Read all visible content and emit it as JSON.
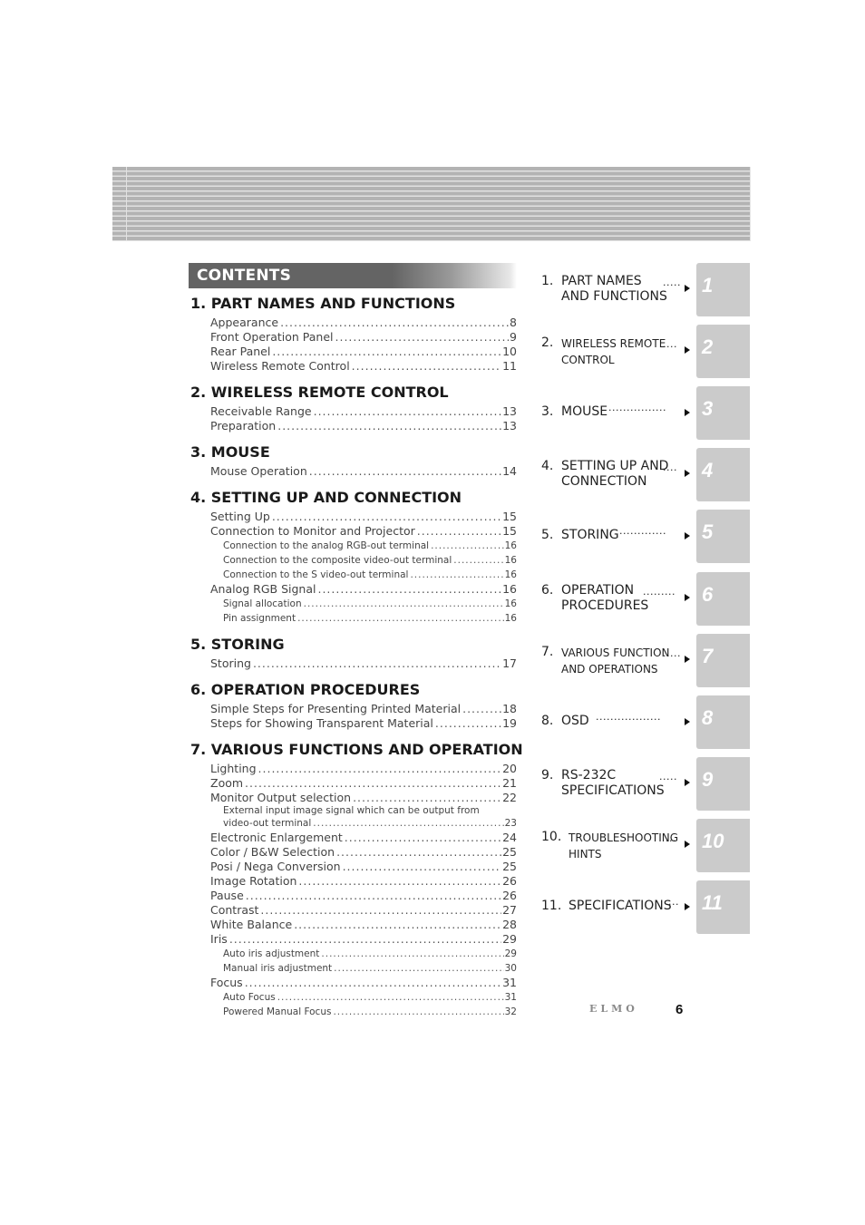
{
  "contents_title": "CONTENTS",
  "sections": [
    {
      "title": "1. PART NAMES AND FUNCTIONS",
      "entries": [
        {
          "label": "Appearance",
          "page": "8"
        },
        {
          "label": "Front Operation Panel",
          "page": "9"
        },
        {
          "label": "Rear Panel",
          "page": "10"
        },
        {
          "label": "Wireless Remote Control",
          "page": "11"
        }
      ]
    },
    {
      "title": "2. WIRELESS REMOTE CONTROL",
      "entries": [
        {
          "label": "Receivable Range",
          "page": "13"
        },
        {
          "label": "Preparation",
          "page": "13"
        }
      ]
    },
    {
      "title": "3. MOUSE",
      "entries": [
        {
          "label": "Mouse Operation",
          "page": "14"
        }
      ]
    },
    {
      "title": "4. SETTING UP AND CONNECTION",
      "entries": [
        {
          "label": "Setting Up",
          "page": "15"
        },
        {
          "label": "Connection to Monitor and Projector",
          "page": "15"
        },
        {
          "label": "Connection to the analog RGB-out terminal",
          "page": "16",
          "sub": true
        },
        {
          "label": "Connection to the composite video-out terminal",
          "page": "16",
          "sub": true
        },
        {
          "label": "Connection to the S video-out terminal",
          "page": "16",
          "sub": true
        },
        {
          "label": "Analog RGB Signal",
          "page": "16"
        },
        {
          "label": "Signal allocation",
          "page": "16",
          "sub": true
        },
        {
          "label": "Pin assignment",
          "page": "16",
          "sub": true
        }
      ]
    },
    {
      "title": "5. STORING",
      "entries": [
        {
          "label": "Storing",
          "page": "17"
        }
      ]
    },
    {
      "title": "6. OPERATION PROCEDURES",
      "entries": [
        {
          "label": "Simple Steps for Presenting Printed Material",
          "page": "18"
        },
        {
          "label": "Steps for Showing Transparent Material",
          "page": "19"
        }
      ]
    },
    {
      "title": "7. VARIOUS FUNCTIONS AND OPERATION",
      "entries": [
        {
          "label": "Lighting",
          "page": "20"
        },
        {
          "label": "Zoom",
          "page": "21"
        },
        {
          "label": "Monitor Output selection",
          "page": "22"
        },
        {
          "label": "External input image signal which can be output from",
          "label2": "video-out terminal",
          "page": "23",
          "sub": true
        },
        {
          "label": "Electronic Enlargement",
          "page": "24"
        },
        {
          "label": "Color / B&W Selection",
          "page": "25"
        },
        {
          "label": "Posi / Nega Conversion",
          "page": "25"
        },
        {
          "label": "Image Rotation",
          "page": "26"
        },
        {
          "label": "Pause",
          "page": "26"
        },
        {
          "label": "Contrast",
          "page": "27"
        },
        {
          "label": "White Balance",
          "page": "28"
        },
        {
          "label": "Iris",
          "page": "29"
        },
        {
          "label": "Auto iris adjustment",
          "page": "29",
          "sub": true
        },
        {
          "label": "Manual iris adjustment",
          "page": "30",
          "sub": true
        },
        {
          "label": "Focus",
          "page": "31"
        },
        {
          "label": "Auto Focus",
          "page": "31",
          "sub": true
        },
        {
          "label": "Powered Manual Focus",
          "page": "32",
          "sub": true
        }
      ]
    }
  ],
  "chapter_index": [
    {
      "num": "1.",
      "line1": "PART NAMES",
      "line2": "AND FUNCTIONS",
      "leader": "·····",
      "tab": "1"
    },
    {
      "num": "2.",
      "line1": "WIRELESS REMOTE",
      "line2": "CONTROL",
      "leader": "····",
      "tab": "2",
      "small": true
    },
    {
      "num": "3.",
      "line1": "MOUSE",
      "line2": "",
      "leader": "················",
      "tab": "3"
    },
    {
      "num": "4.",
      "line1": "SETTING UP AND",
      "line2": "CONNECTION",
      "leader": "····",
      "tab": "4"
    },
    {
      "num": "5.",
      "line1": "STORING",
      "line2": "",
      "leader": "·············",
      "tab": "5"
    },
    {
      "num": "6.",
      "line1": "OPERATION",
      "line2": "PROCEDURES",
      "leader": "·········",
      "tab": "6"
    },
    {
      "num": "7.",
      "line1": "VARIOUS FUNCTION",
      "line2": "AND OPERATIONS",
      "leader": "·····",
      "tab": "7",
      "small": true
    },
    {
      "num": "8.",
      "line1": "OSD",
      "line2": "",
      "leader": "··················",
      "tab": "8"
    },
    {
      "num": "9.",
      "line1": "RS-232C",
      "line2": "SPECIFICATIONS",
      "leader": "·····",
      "tab": "9"
    },
    {
      "num": "10.",
      "line1": "TROUBLESHOOTING",
      "line2": "HINTS",
      "leader": "···",
      "tab": "10",
      "small": true
    },
    {
      "num": "11.",
      "line1": "SPECIFICATIONS",
      "line2": "",
      "leader": "···",
      "tab": "11"
    }
  ],
  "footer": {
    "brand": "ELMO",
    "page_number": "6"
  },
  "colors": {
    "title_bar": "#646464",
    "tab_gray": "#cbcbcb",
    "header_stripe": "#b3b3b3"
  }
}
